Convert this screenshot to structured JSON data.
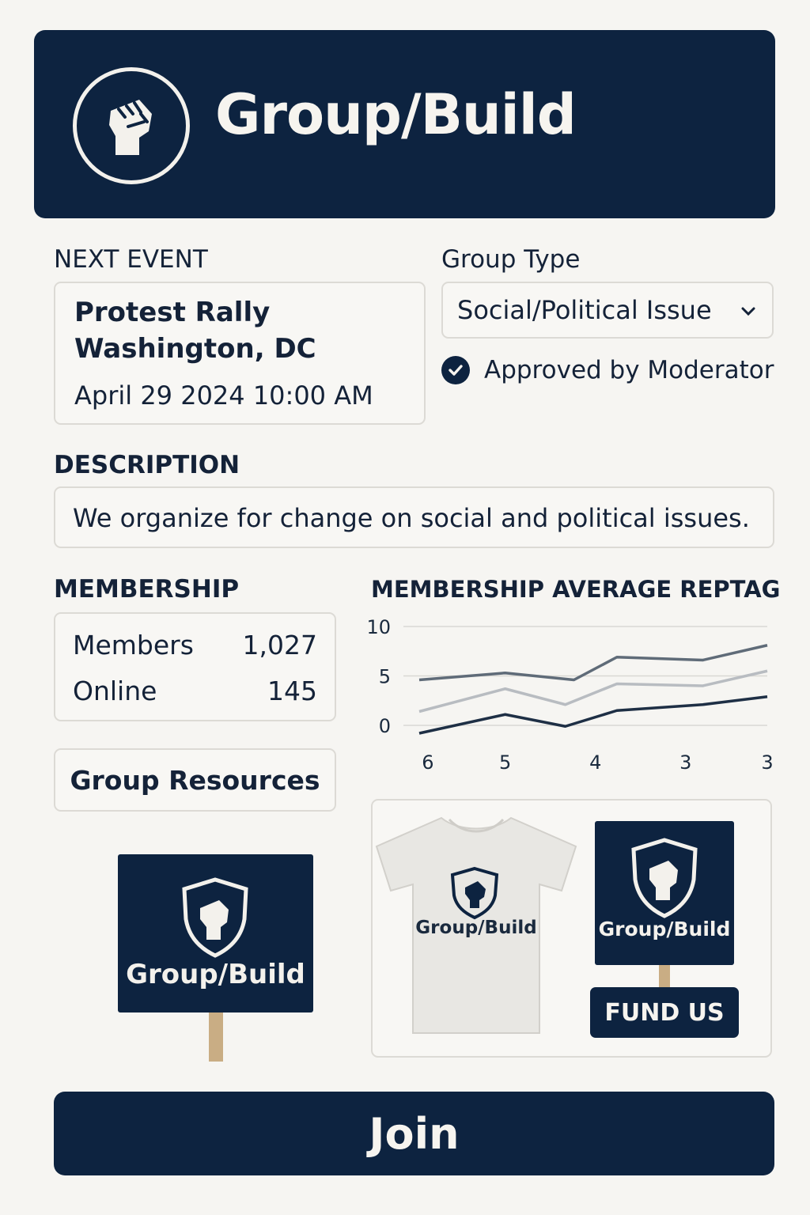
{
  "app": {
    "title": "Group/Build",
    "logo_icon": "raised-fist-icon"
  },
  "event": {
    "label": "NEXT EVENT",
    "title": "Protest Rally",
    "location": "Washington, DC",
    "datetime": "April 29 2024 10:00 AM"
  },
  "group_type": {
    "label": "Group Type",
    "selected": "Social/Political Issue",
    "approved_text": "Approved by Moderator"
  },
  "description": {
    "label": "DESCRIPTION",
    "text": "We organize for change on social and political issues."
  },
  "membership": {
    "label": "MEMBERSHIP",
    "rows": [
      {
        "name": "Members",
        "value": "1,027"
      },
      {
        "name": "Online",
        "value": "145"
      }
    ]
  },
  "resources": {
    "button_label": "Group Resources"
  },
  "merch": {
    "sign_text": "Group/Build",
    "shirt_text": "Group/Build",
    "small_sign_text": "Group/Build",
    "fund_label": "FUND US"
  },
  "join": {
    "label": "Join"
  },
  "colors": {
    "navy": "#0d2340",
    "background": "#f6f5f2",
    "line_dark": "#1e2f45",
    "line_mid": "#5f6b78",
    "line_light": "#b8bcc1"
  },
  "chart_data": {
    "type": "line",
    "title": "MEMBERSHIP AVERAGE REPTAG",
    "categories": [
      "6",
      "5",
      "4",
      "3",
      "3"
    ],
    "x_positions": [
      0,
      1,
      2,
      3,
      4
    ],
    "x_ticks": [
      {
        "label": "6",
        "at": 0.1
      },
      {
        "label": "5",
        "at": 1.0
      },
      {
        "label": "4",
        "at": 2.05
      },
      {
        "label": "3",
        "at": 3.1
      },
      {
        "label": "3",
        "at": 4.05
      }
    ],
    "series": [
      {
        "color": "#5f6b78",
        "x": [
          0,
          1,
          1.8,
          2.3,
          3.3,
          4.05
        ],
        "values": [
          4.6,
          5.3,
          4.6,
          6.9,
          6.6,
          8.1
        ]
      },
      {
        "color": "#b8bcc1",
        "x": [
          0,
          1,
          1.7,
          2.3,
          3.3,
          4.05
        ],
        "values": [
          1.4,
          3.7,
          2.1,
          4.2,
          4.0,
          5.5
        ]
      },
      {
        "color": "#1e2f45",
        "x": [
          0,
          1,
          1.7,
          2.3,
          3.3,
          4.05
        ],
        "values": [
          -0.8,
          1.1,
          -0.1,
          1.5,
          2.1,
          2.9
        ]
      }
    ],
    "yticks": [
      0,
      5,
      10
    ],
    "ylim": [
      -1,
      10
    ],
    "xlim": [
      0,
      4.05
    ],
    "grid": true
  }
}
